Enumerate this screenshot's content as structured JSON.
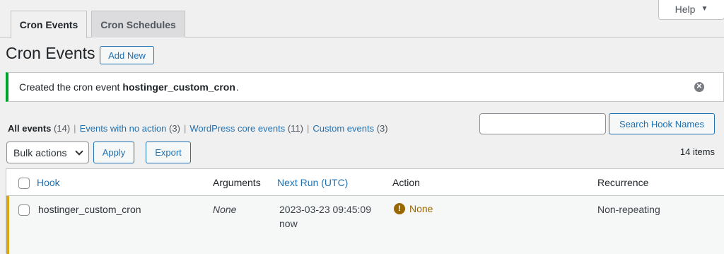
{
  "help": {
    "label": "Help",
    "caret": "▼"
  },
  "tabs": [
    {
      "label": "Cron Events",
      "active": true
    },
    {
      "label": "Cron Schedules",
      "active": false
    }
  ],
  "page": {
    "title": "Cron Events",
    "add_new": "Add New"
  },
  "notice": {
    "text": "Created the cron event",
    "hook": "hostinger_custom_cron",
    "period": ".",
    "dismiss_icon": "✕"
  },
  "filters": [
    {
      "label": "All events",
      "count": "(14)",
      "current": true
    },
    {
      "label": "Events with no action",
      "count": "(3)",
      "current": false
    },
    {
      "label": "WordPress core events",
      "count": "(11)",
      "current": false
    },
    {
      "label": "Custom events",
      "count": "(3)",
      "current": false
    }
  ],
  "search": {
    "placeholder": "",
    "value": "",
    "button": "Search Hook Names"
  },
  "bulk": {
    "selected": "Bulk actions",
    "apply": "Apply",
    "export": "Export"
  },
  "items_count": "14 items",
  "table": {
    "columns": {
      "hook": "Hook",
      "arguments": "Arguments",
      "next_run": "Next Run (UTC)",
      "action": "Action",
      "recurrence": "Recurrence"
    },
    "rows": [
      {
        "hook": "hostinger_custom_cron",
        "arguments": "None",
        "next_run": "2023-03-23 09:45:09",
        "next_run_rel": "now",
        "action": "None",
        "action_icon": "!",
        "recurrence": "Non-repeating"
      }
    ]
  },
  "colors": {
    "link": "#2271b1",
    "success": "#00a32a",
    "warning": "#dba617",
    "warning_text": "#996800"
  }
}
